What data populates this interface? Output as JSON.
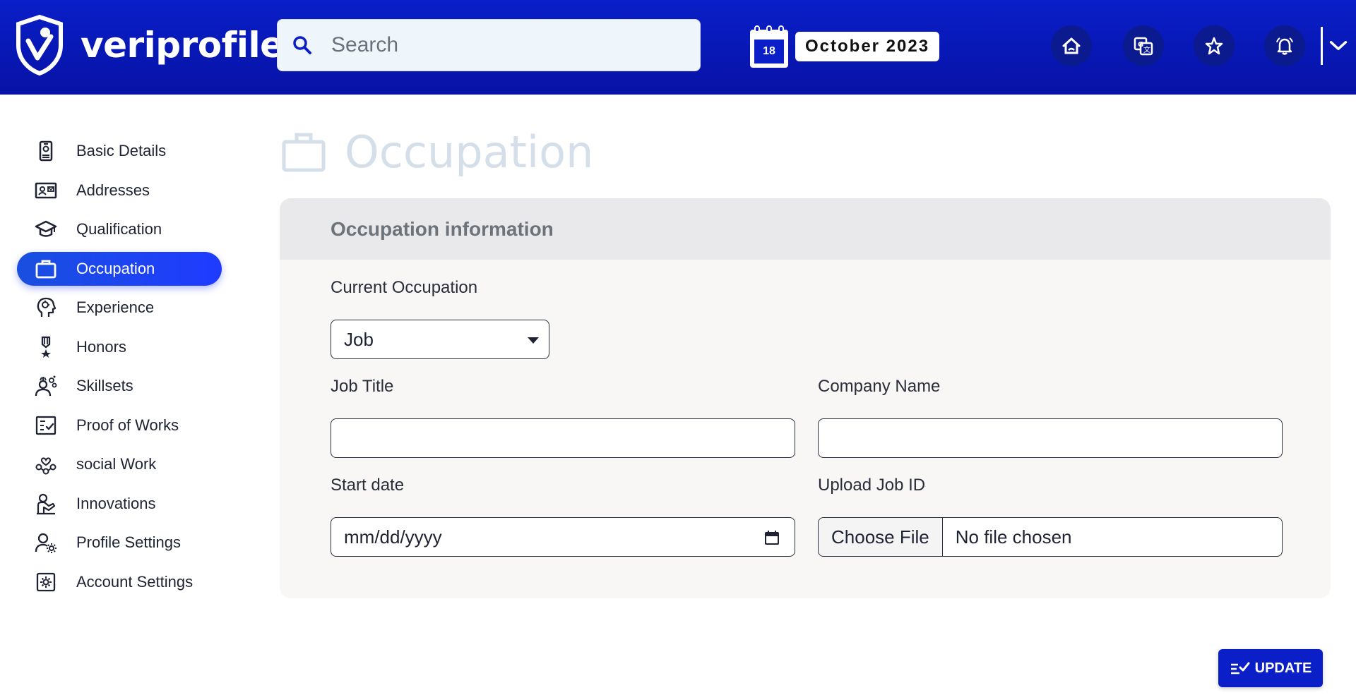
{
  "header": {
    "brand": "veriprofile",
    "search_placeholder": "Search",
    "calendar_day": "18",
    "month_year": "October 2023",
    "buttons": [
      "home-icon",
      "translate-icon",
      "star-icon",
      "bell-icon"
    ],
    "accent_color": "#0a1fc8"
  },
  "sidebar": {
    "items": [
      {
        "label": "Basic Details",
        "icon": "id-badge-icon",
        "active": false
      },
      {
        "label": "Addresses",
        "icon": "address-card-icon",
        "active": false
      },
      {
        "label": "Qualification",
        "icon": "graduation-cap-icon",
        "active": false
      },
      {
        "label": "Occupation",
        "icon": "briefcase-icon",
        "active": true
      },
      {
        "label": "Experience",
        "icon": "brain-head-icon",
        "active": false
      },
      {
        "label": "Honors",
        "icon": "medal-icon",
        "active": false
      },
      {
        "label": "Skillsets",
        "icon": "skills-person-icon",
        "active": false
      },
      {
        "label": "Proof of Works",
        "icon": "checklist-icon",
        "active": false
      },
      {
        "label": "social Work",
        "icon": "hands-heart-icon",
        "active": false
      },
      {
        "label": "Innovations",
        "icon": "innovation-icon",
        "active": false
      },
      {
        "label": "Profile Settings",
        "icon": "user-gear-icon",
        "active": false
      },
      {
        "label": "Account Settings",
        "icon": "settings-box-icon",
        "active": false
      }
    ]
  },
  "main": {
    "page_title": "Occupation",
    "card_title": "Occupation information",
    "current_occupation_label": "Current Occupation",
    "current_occupation_value": "Job",
    "job_title_label": "Job Title",
    "job_title_value": "",
    "company_name_label": "Company Name",
    "company_name_value": "",
    "start_date_label": "Start date",
    "start_date_placeholder": "mm/dd/yyyy",
    "upload_label": "Upload Job ID",
    "choose_file_label": "Choose File",
    "file_status": "No file chosen",
    "update_label": "UPDATE"
  }
}
